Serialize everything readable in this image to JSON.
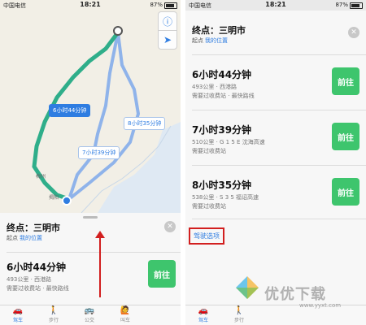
{
  "status_bar": {
    "carrier": "中国电信",
    "time": "18:21",
    "battery": "87%"
  },
  "map": {
    "info_icon": "info-icon",
    "locate_icon": "location-arrow-icon",
    "route_labels": [
      {
        "text": "6小时44分钟",
        "primary": true
      },
      {
        "text": "8小时35分钟",
        "primary": false
      },
      {
        "text": "7小时39分钟",
        "primary": false
      }
    ],
    "cities": [
      "梅州",
      "揭阳"
    ]
  },
  "left_sheet": {
    "title": "终点：三明市",
    "origin_prefix": "起点",
    "origin_value": "我的位置",
    "first_route": {
      "time": "6小时44分钟",
      "meta1": "493公里 · 西港路",
      "meta2": "需要过收费站 · 最快路线",
      "go_label": "前往"
    }
  },
  "right_sheet": {
    "title": "终点：三明市",
    "origin_prefix": "起点",
    "origin_value": "我的位置",
    "routes": [
      {
        "time": "6小时44分钟",
        "meta1": "493公里 · 西港路",
        "meta2": "需要过收费站 · 最快路线",
        "go_label": "前往"
      },
      {
        "time": "7小时39分钟",
        "meta1": "510公里 · G 1 5 E 沈海高速",
        "meta2": "需要过收费站",
        "go_label": "前往"
      },
      {
        "time": "8小时35分钟",
        "meta1": "538公里 · S 3 5 福诏高速",
        "meta2": "需要过收费站",
        "go_label": "前往"
      }
    ],
    "options_link": "驾驶选项"
  },
  "tabbar": {
    "tabs": [
      {
        "label": "驾车",
        "icon": "car-icon",
        "active": true
      },
      {
        "label": "步行",
        "icon": "walk-icon",
        "active": false
      },
      {
        "label": "公交",
        "icon": "bus-icon",
        "active": false
      },
      {
        "label": "叫车",
        "icon": "hail-icon",
        "active": false
      }
    ]
  },
  "watermark": {
    "text": "优优下载",
    "url": "www.yyxt.com"
  },
  "colors": {
    "accent": "#2f7de1",
    "go_green": "#3ec56d",
    "route_main": "#2fae8a",
    "route_alt": "#8fb3ea",
    "annotation_red": "#d21f1f"
  }
}
